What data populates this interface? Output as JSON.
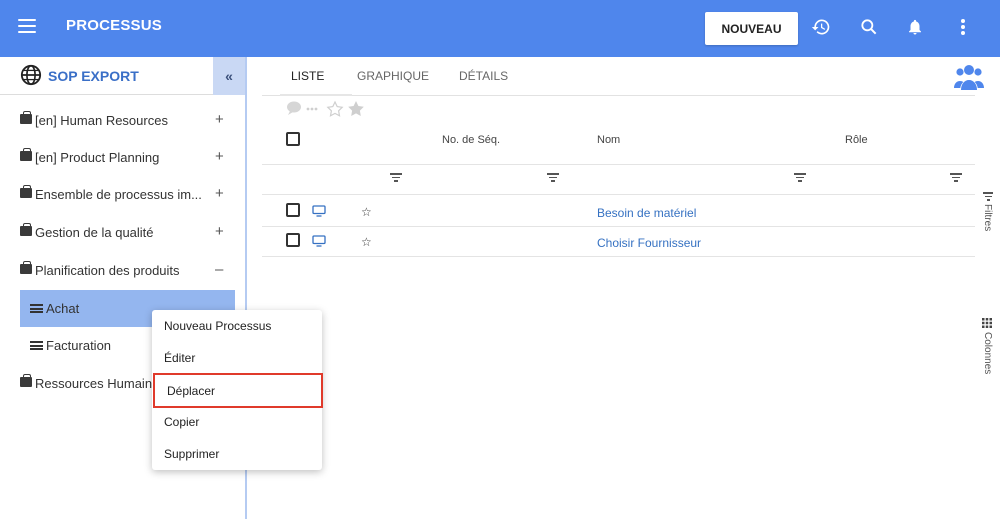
{
  "header": {
    "title": "PROCESSUS",
    "new_button": "NOUVEAU",
    "icons": [
      "menu-icon",
      "history-icon",
      "search-icon",
      "bell-icon",
      "more-vert-icon"
    ],
    "accent": "#4f86ec"
  },
  "sidebar": {
    "title": "SOP EXPORT",
    "collapse": "«",
    "items": [
      {
        "label": "[en] Human Resources",
        "toggle": "+"
      },
      {
        "label": "[en] Product Planning",
        "toggle": "+"
      },
      {
        "label": "Ensemble de processus im...",
        "toggle": "+"
      },
      {
        "label": "Gestion de la qualité",
        "toggle": "+"
      },
      {
        "label": "Planification des produits",
        "toggle": "–"
      },
      {
        "label": "Ressources Humain",
        "toggle": ""
      }
    ],
    "sub_items": [
      {
        "label": "Achat"
      },
      {
        "label": "Facturation"
      }
    ]
  },
  "context_menu": {
    "items": [
      "Nouveau Processus",
      "Éditer",
      "Déplacer",
      "Copier",
      "Supprimer"
    ]
  },
  "main": {
    "tabs": [
      "LISTE",
      "GRAPHIQUE",
      "DÉTAILS"
    ],
    "columns": [
      "No. de Séq.",
      "Nom",
      "Rôle"
    ],
    "rows": [
      {
        "name": "Besoin de matériel"
      },
      {
        "name": "Choisir Fournisseur"
      }
    ],
    "side_labels": [
      "Filtres",
      "Colonnes"
    ]
  }
}
